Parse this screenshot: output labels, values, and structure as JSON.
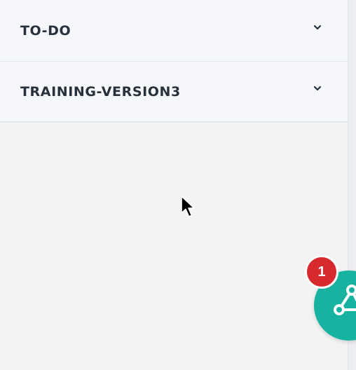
{
  "sections": [
    {
      "label": "TO-DO",
      "icon": "chevron-down-icon"
    },
    {
      "label": "TRAINING-VERSION3",
      "icon": "chevron-down-icon"
    }
  ],
  "fab": {
    "icon": "network-icon",
    "color": "#17b2a0",
    "badge_count": "1",
    "badge_color": "#d72a2e"
  }
}
